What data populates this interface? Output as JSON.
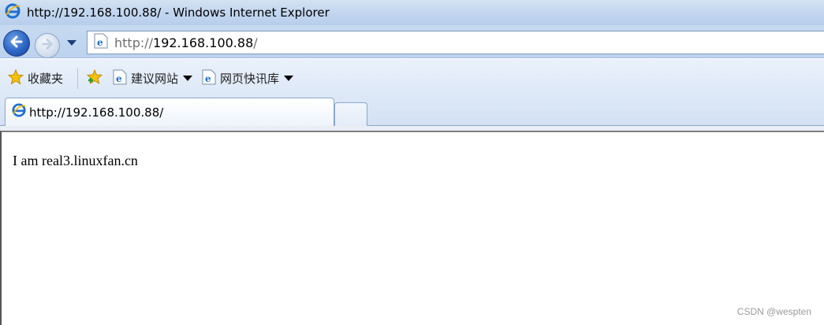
{
  "window": {
    "title": "http://192.168.100.88/ - Windows Internet Explorer"
  },
  "address": {
    "url_prefix": "http://",
    "url_host": "192.168.100.88",
    "url_suffix": "/"
  },
  "favorites": {
    "favorites_label": "收藏夹",
    "suggested_sites": "建议网站",
    "web_slice_gallery": "网页快讯库"
  },
  "tabs": [
    {
      "label": "http://192.168.100.88/"
    }
  ],
  "page": {
    "body_text": "I am real3.linuxfan.cn"
  },
  "watermark": "CSDN @wespten",
  "colors": {
    "chrome_blue": "#c2d6ef",
    "back_button": "#2c65c4"
  },
  "icons": [
    "ie-logo-icon",
    "back-arrow-icon",
    "forward-arrow-icon",
    "dropdown-arrow-icon",
    "page-icon",
    "star-icon",
    "add-favorite-icon"
  ]
}
